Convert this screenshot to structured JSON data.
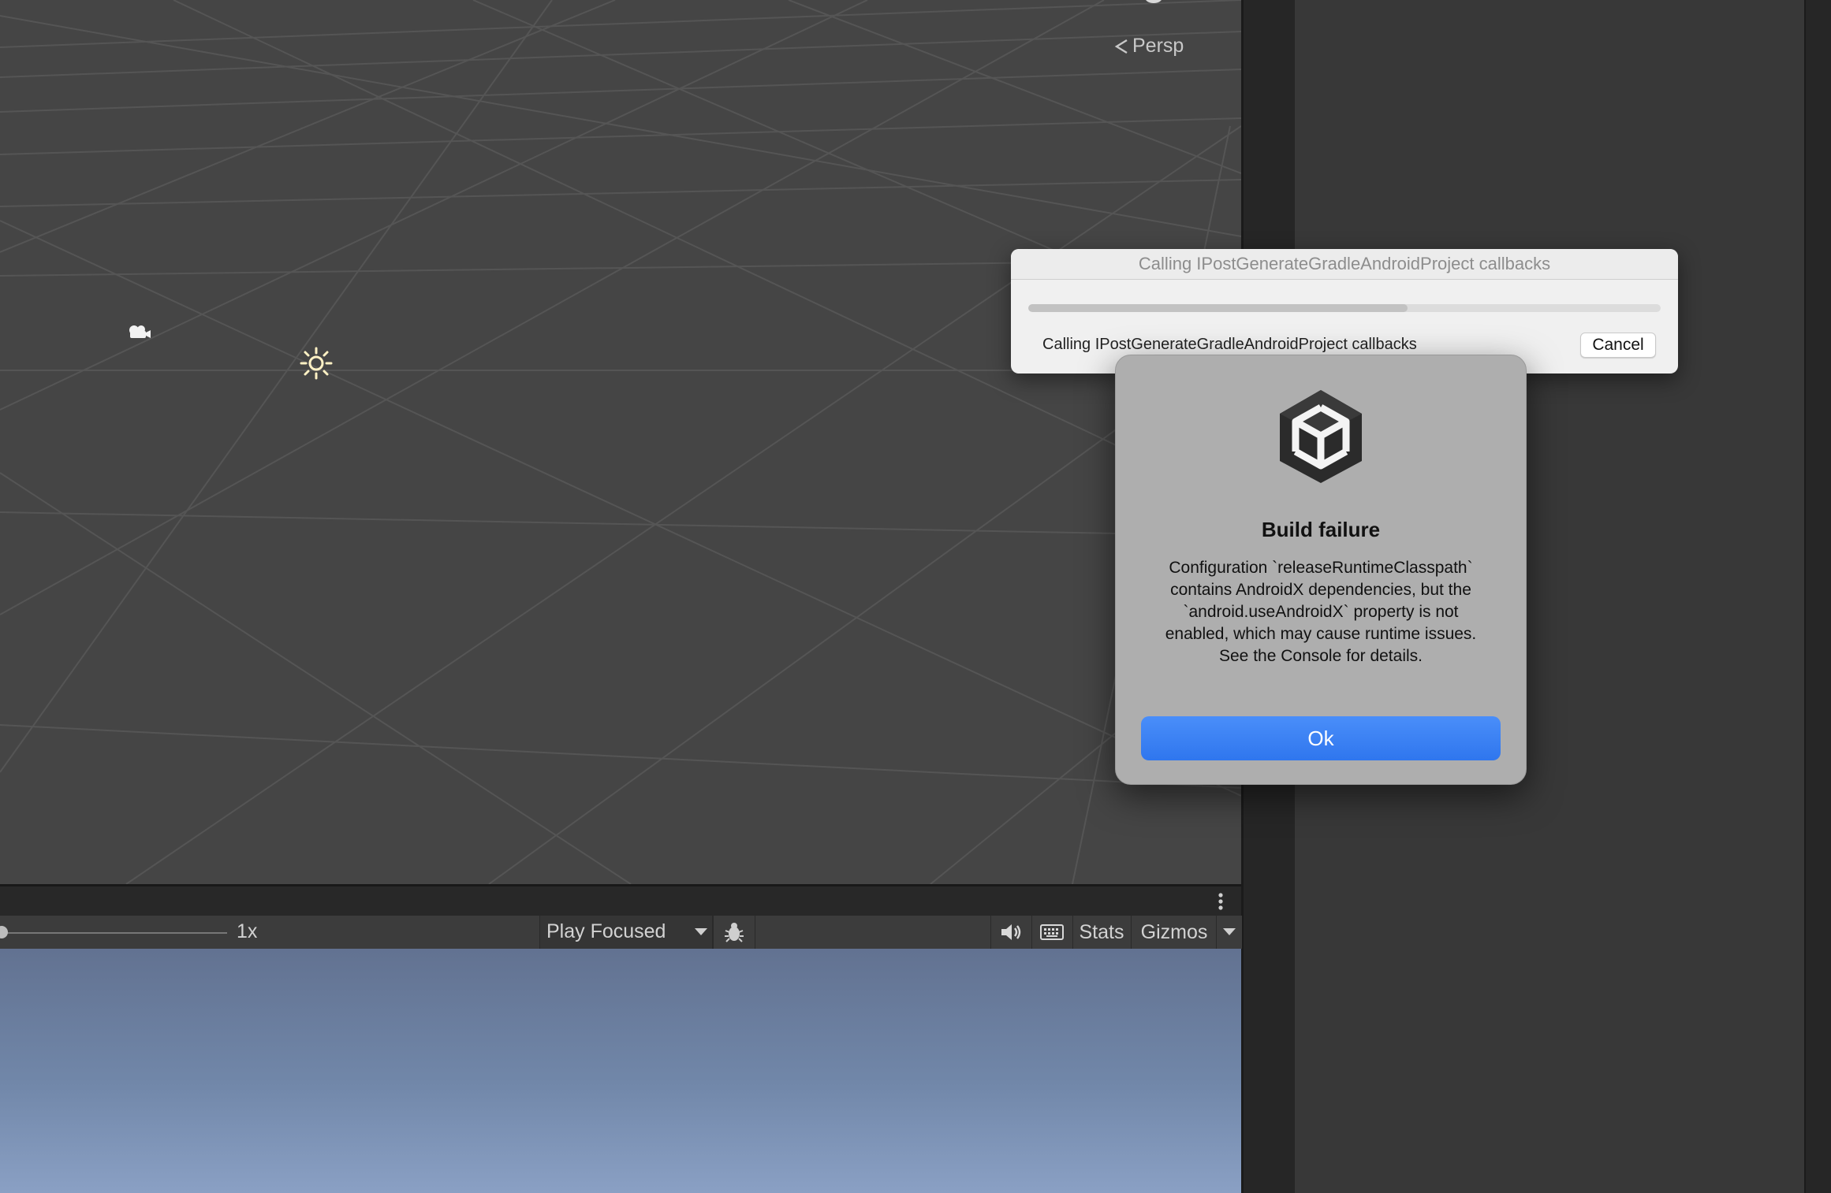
{
  "scene": {
    "view_mode_label": "Persp",
    "camera_icon": "scene-camera-icon",
    "light_icon": "directional-light-icon"
  },
  "game_toolbar": {
    "scale_label": "1x",
    "play_mode_label": "Play Focused",
    "stats_label": "Stats",
    "gizmos_label": "Gizmos",
    "icons": [
      "debug-bug-icon",
      "audio-mute-icon",
      "keyboard-icon",
      "chevron-down-icon"
    ]
  },
  "progress_dialog": {
    "title": "Calling IPostGenerateGradleAndroidProject callbacks",
    "message": "Calling IPostGenerateGradleAndroidProject callbacks",
    "cancel_label": "Cancel",
    "progress": 0.6
  },
  "alert": {
    "title": "Build failure",
    "message": "Configuration `releaseRuntimeClasspath` contains AndroidX dependencies, but the `android.useAndroidX` property is not enabled, which may cause runtime issues. See the Console for details.",
    "ok_label": "Ok",
    "icon": "unity-logo-icon"
  },
  "colors": {
    "accent_blue": "#3b82f6",
    "scene_background": "#454545",
    "game_sky": "#7187a9"
  }
}
